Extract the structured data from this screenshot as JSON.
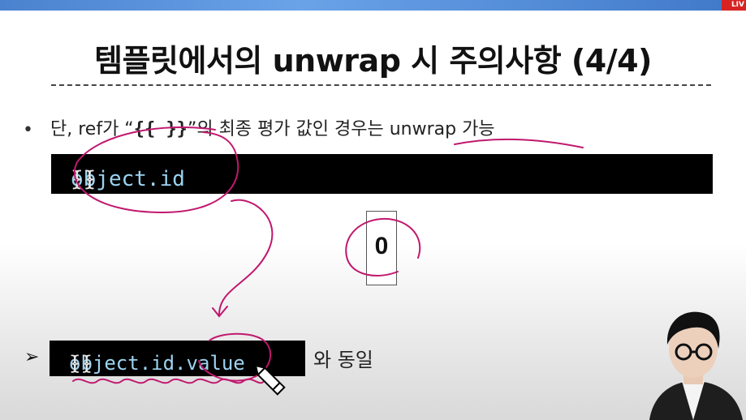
{
  "live_badge": "LIV",
  "title": "템플릿에서의 unwrap 시 주의사항 (4/4)",
  "bullet_symbol": "•",
  "line1": {
    "prefix": "단, ref가 “",
    "code": "{{ }}",
    "suffix": "”의 최종 평가 값인 경우는 unwrap 가능"
  },
  "code_block1": {
    "open": "{{ ",
    "expr": "object.id",
    "close": " }}"
  },
  "evaluated_value": "0",
  "arrow_symbol": "➢",
  "code_block2": {
    "open": "{{ ",
    "expr": "object.id.value",
    "close": " }}"
  },
  "equivalent_label": "와 동일",
  "colors": {
    "annotation_ink": "#c0186e",
    "code_bg": "#000000",
    "code_ident": "#9cd3f0",
    "header_bar": "#4a82cf",
    "live_badge": "#d92323"
  }
}
